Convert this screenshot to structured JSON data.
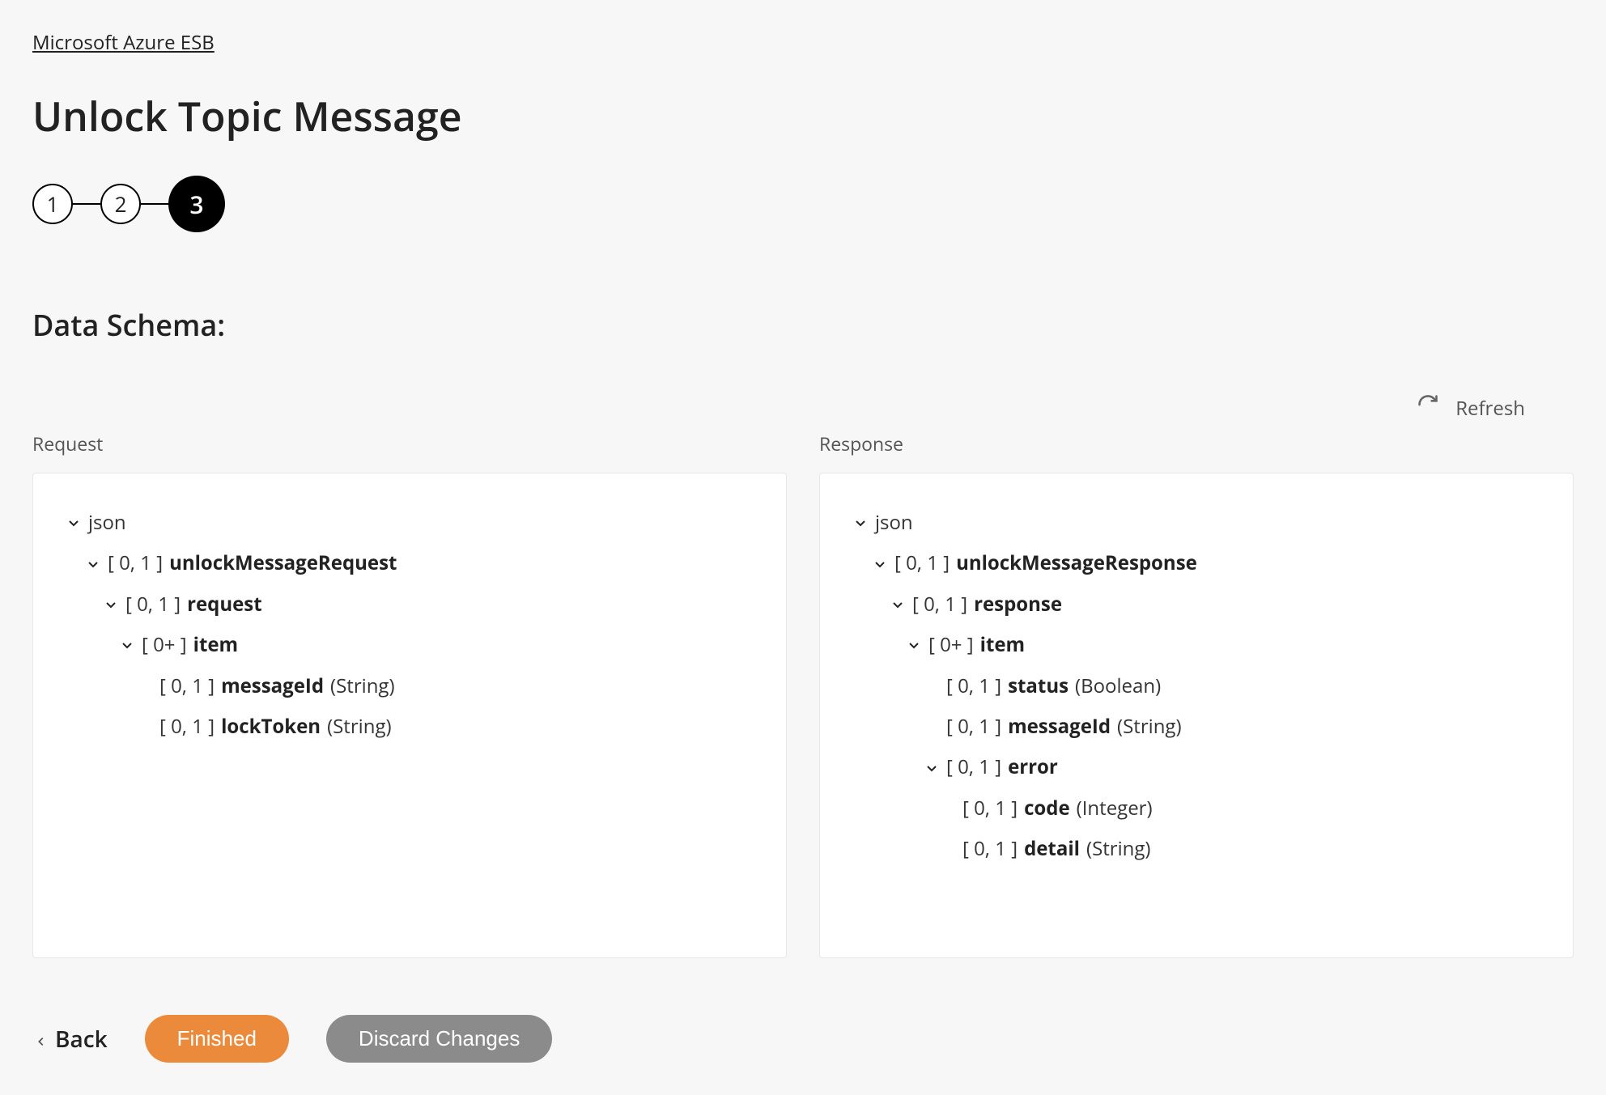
{
  "breadcrumb": "Microsoft Azure ESB",
  "title": "Unlock Topic Message",
  "steps": {
    "s1": "1",
    "s2": "2",
    "s3": "3"
  },
  "section_title": "Data Schema:",
  "refresh_label": "Refresh",
  "columns": {
    "request": {
      "label": "Request",
      "root": "json",
      "node1": {
        "card": "[ 0, 1 ]",
        "name": "unlockMessageRequest"
      },
      "node2": {
        "card": "[ 0, 1 ]",
        "name": "request"
      },
      "node3": {
        "card": "[ 0+ ]",
        "name": "item"
      },
      "leaf1": {
        "card": "[ 0, 1 ]",
        "name": "messageId",
        "type": "(String)"
      },
      "leaf2": {
        "card": "[ 0, 1 ]",
        "name": "lockToken",
        "type": "(String)"
      }
    },
    "response": {
      "label": "Response",
      "root": "json",
      "node1": {
        "card": "[ 0, 1 ]",
        "name": "unlockMessageResponse"
      },
      "node2": {
        "card": "[ 0, 1 ]",
        "name": "response"
      },
      "node3": {
        "card": "[ 0+ ]",
        "name": "item"
      },
      "leaf1": {
        "card": "[ 0, 1 ]",
        "name": "status",
        "type": "(Boolean)"
      },
      "leaf2": {
        "card": "[ 0, 1 ]",
        "name": "messageId",
        "type": "(String)"
      },
      "node4": {
        "card": "[ 0, 1 ]",
        "name": "error"
      },
      "leaf3": {
        "card": "[ 0, 1 ]",
        "name": "code",
        "type": "(Integer)"
      },
      "leaf4": {
        "card": "[ 0, 1 ]",
        "name": "detail",
        "type": "(String)"
      }
    }
  },
  "footer": {
    "back": "Back",
    "finished": "Finished",
    "discard": "Discard Changes"
  }
}
